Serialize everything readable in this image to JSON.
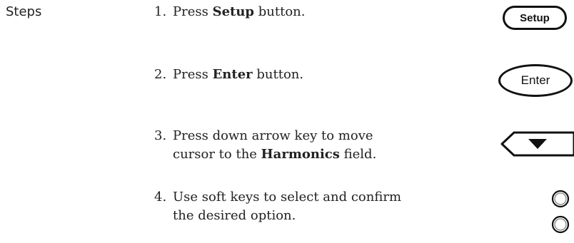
{
  "section_label": "Steps",
  "steps": [
    {
      "number": "1.",
      "pre": "Press ",
      "bold": "Setup",
      "post": " button."
    },
    {
      "number": "2.",
      "pre": "Press ",
      "bold": "Enter",
      "post": " button."
    },
    {
      "number": "3.",
      "line1": "Press down arrow key to move",
      "pre": "cursor to the ",
      "bold": "Harmonics",
      "post": " field."
    },
    {
      "number": "4.",
      "line1": "Use soft keys to select and confirm",
      "line2": "the desired option."
    }
  ],
  "keys": {
    "setup_label": "Setup",
    "enter_label": "Enter",
    "arrow_icon": "down-arrow-key-icon",
    "soft_key_icon": "soft-key-icon"
  }
}
